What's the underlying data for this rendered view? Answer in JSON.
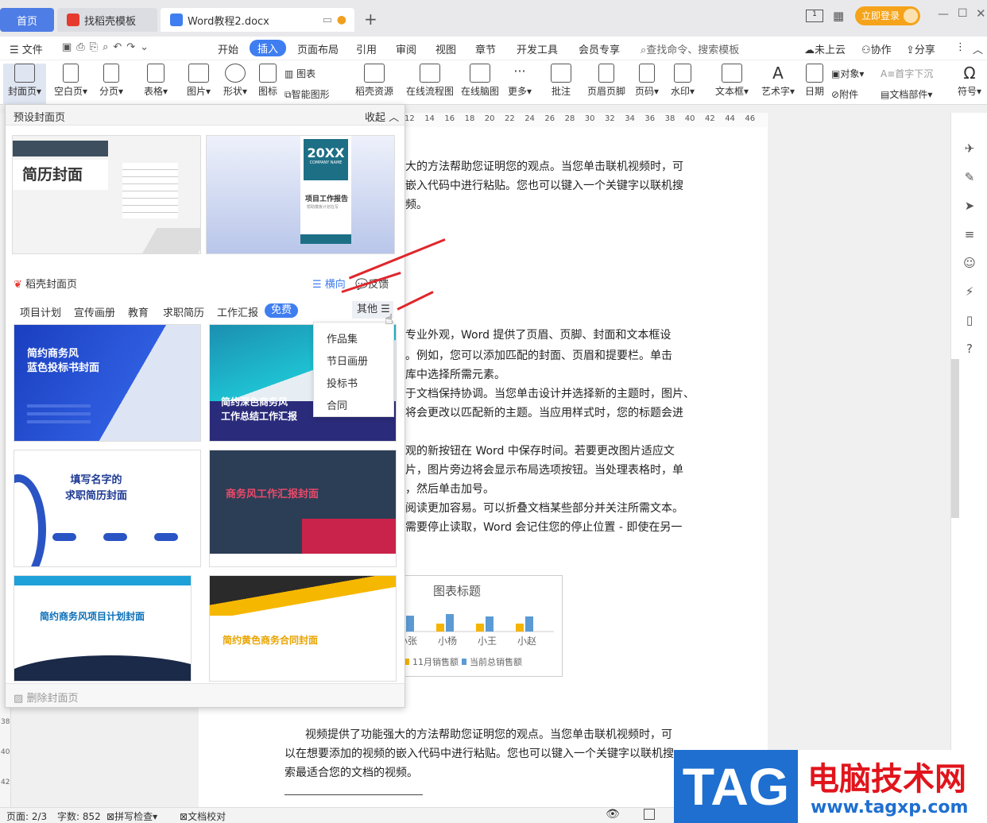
{
  "tabs": [
    {
      "label": "首页"
    },
    {
      "label": "找稻壳模板"
    },
    {
      "label": "Word教程2.docx"
    }
  ],
  "title_right": {
    "login": "立即登录"
  },
  "menubar": {
    "file": "文件",
    "items": [
      "开始",
      "插入",
      "页面布局",
      "引用",
      "审阅",
      "视图",
      "章节",
      "开发工具",
      "会员专享"
    ],
    "active": "插入",
    "search": "查找命令、搜索模板",
    "cloud": "未上云",
    "collab": "协作",
    "share": "分享"
  },
  "ribbon": {
    "buttons": [
      "封面页",
      "空白页",
      "分页",
      "表格",
      "图片",
      "形状",
      "图标",
      "稻壳资源",
      "在线流程图",
      "在线脑图",
      "更多",
      "批注",
      "页眉页脚",
      "页码",
      "水印",
      "文本框",
      "艺术字",
      "日期",
      "符号"
    ],
    "small": [
      "图表",
      "智能图形",
      "对象",
      "首字下沉",
      "附件",
      "文档部件"
    ]
  },
  "panel": {
    "preset_title": "预设封面页",
    "collapse": "收起",
    "preset1": {
      "title": "简历封面"
    },
    "preset2": {
      "year": "20XX",
      "company": "COMPANY NAME",
      "title": "项目工作报告",
      "sub": "帮助模板计划在写"
    },
    "daoke": "稻壳封面页",
    "landscape": "横向",
    "feedback": "反馈",
    "categories": [
      "项目计划",
      "宣传画册",
      "教育",
      "求职简历",
      "工作汇报",
      "免费"
    ],
    "active_category": "免费",
    "other": "其他",
    "cards": [
      {
        "title": "简约商务风\n蓝色投标书封面"
      },
      {
        "title": "简约深色商务风\n工作总结工作汇报"
      },
      {
        "title": "填写名字的\n求职简历封面"
      },
      {
        "title": "商务风工作汇报封面"
      },
      {
        "title": "简约商务风项目计划封面"
      },
      {
        "title": "简约黄色商务合同封面"
      }
    ],
    "delete": "删除封面页"
  },
  "dropdown": [
    "作品集",
    "节日画册",
    "投标书",
    "合同"
  ],
  "doc": {
    "lines1": [
      "大的方法帮助您证明您的观点。当您单击联机视频时，可",
      "嵌入代码中进行粘贴。您也可以键入一个关键字以联机搜",
      "频。"
    ],
    "lines2": [
      "专业外观，Word 提供了页眉、页脚、封面和文本框设",
      "。例如，您可以添加匹配的封面、页眉和提要栏。单击",
      "库中选择所需元素。",
      "于文档保持协调。当您单击设计并选择新的主题时，图片、",
      "将会更改以匹配新的主题。当应用样式时，您的标题会进",
      "",
      "观的新按钮在 Word 中保存时间。若要更改图片适应文",
      "片，图片旁边将会显示布局选项按钮。当处理表格时，单",
      "，然后单击加号。",
      "阅读更加容易。可以折叠文档某些部分并关注所需文本。",
      "需要停止读取，Word 会记住您的停止位置 - 即使在另一"
    ],
    "chart_title": "图表标题",
    "lines3": [
      "视频提供了功能强大的方法帮助您证明您的观点。当您单击联机视频时，可",
      "以在想要添加的视频的嵌入代码中进行粘贴。您也可以键入一个关键字以联机搜",
      "索最适合您的文档的视频。"
    ]
  },
  "chart_data": {
    "type": "bar",
    "title": "图表标题",
    "categories": [
      "小张",
      "小杨",
      "小王",
      "小赵"
    ],
    "series": [
      {
        "name": "11月销售额",
        "color": "#f5b400",
        "values": [
          1,
          1,
          1,
          1
        ]
      },
      {
        "name": "当前总销售额",
        "color": "#5b9bd5",
        "values": [
          2,
          2.2,
          1.9,
          1.9
        ]
      }
    ]
  },
  "ruler": [
    "12",
    "14",
    "16",
    "18",
    "20",
    "22",
    "24",
    "26",
    "28",
    "30",
    "32",
    "34",
    "36",
    "38",
    "40",
    "42",
    "44",
    "46"
  ],
  "status": {
    "page": "页面: 2/3",
    "words": "字数: 852",
    "spell": "拼写检查",
    "proof": "文档校对"
  },
  "watermark": {
    "tag": "TAG",
    "cn": "电脑技术网",
    "url": "www.tagxp.com"
  }
}
